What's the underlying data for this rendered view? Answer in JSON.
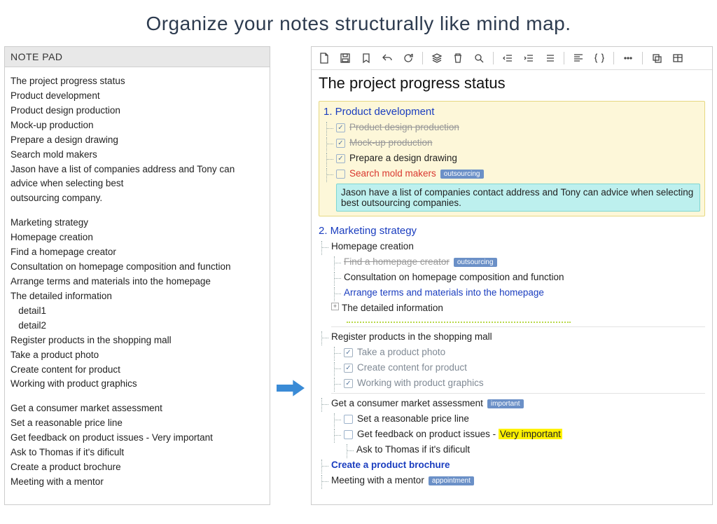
{
  "headline": "Organize your notes structurally like mind map.",
  "notepad": {
    "title": "NOTE PAD",
    "lines": [
      "The project progress status",
      "Product development",
      "Product design production",
      "Mock-up production",
      "Prepare a design drawing",
      "Search mold makers",
      "Jason have a list of companies address and Tony can advice when selecting best",
      "outsourcing company.",
      "",
      "Marketing strategy",
      "Homepage creation",
      "Find a homepage creator",
      "Consultation on homepage composition and function",
      "Arrange terms and materials into the homepage",
      "The detailed information",
      "   detail1",
      "   detail2",
      "Register products in the shopping mall",
      "Take a product photo",
      "Create content for product",
      "Working with product graphics",
      "",
      "Get a consumer market assessment",
      "Set a reasonable price line",
      "Get feedback on product issues - Very important",
      "Ask to Thomas if it's dificult",
      "Create a product brochure",
      "Meeting with a mentor"
    ]
  },
  "toolbar": {
    "icons": [
      "new",
      "save",
      "bookmark",
      "undo",
      "refresh",
      "layers",
      "trash",
      "search",
      "outdent",
      "indent",
      "list",
      "align-left",
      "braces",
      "more",
      "copy",
      "table"
    ]
  },
  "outline": {
    "title": "The project progress status",
    "sec1": {
      "header": "1. Product development",
      "items": {
        "a": "Product design production",
        "b": "Mock-up production",
        "c": "Prepare a design drawing",
        "d": "Search mold makers",
        "d_tag": "outsourcing",
        "d_note": "Jason have a list of companies contact address and Tony can advice when selecting best outsourcing companies."
      }
    },
    "sec2": {
      "header": "2. Marketing strategy",
      "homepage": {
        "label": "Homepage creation",
        "find": "Find a homepage creator",
        "find_tag": "outsourcing",
        "consult": "Consultation on homepage composition and function",
        "arrange": "Arrange terms and materials into the homepage",
        "detailed": "The detailed information"
      },
      "register": {
        "label": "Register products in the shopping mall",
        "a": "Take a product photo",
        "b": "Create content for product",
        "c": "Working with product graphics"
      },
      "assessment": {
        "label": "Get a consumer market assessment",
        "tag": "important",
        "a": "Set a reasonable price line",
        "b_pre": "Get feedback on product issues - ",
        "b_hl": "Very important",
        "b_sub": "Ask to Thomas if it's dificult"
      },
      "brochure": "Create a product brochure",
      "meeting": "Meeting with a mentor",
      "meeting_tag": "appointment"
    }
  }
}
